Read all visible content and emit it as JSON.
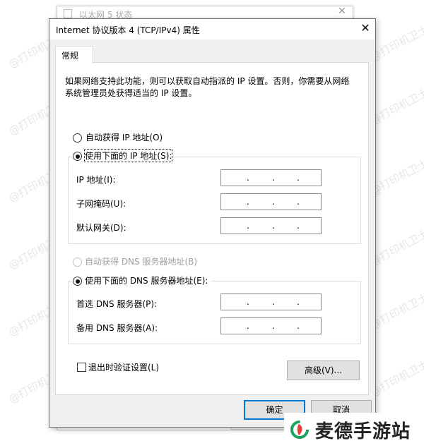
{
  "background_window": {
    "title": "以太网 5 状态"
  },
  "dialog": {
    "title": "Internet 协议版本 4 (TCP/IPv4) 属性",
    "tab_label": "常规",
    "description": "如果网络支持此功能，则可以获取自动指派的 IP 设置。否则，你需要从网络系统管理员处获得适当的 IP 设置。",
    "ip_section": {
      "auto_label": "自动获得 IP 地址(O)",
      "manual_label": "使用下面的 IP 地址(S):",
      "selected": "manual",
      "fields": [
        {
          "label": "IP 地址(I):",
          "value": ". . ."
        },
        {
          "label": "子网掩码(U):",
          "value": ". . ."
        },
        {
          "label": "默认网关(D):",
          "value": ". . ."
        }
      ]
    },
    "dns_section": {
      "auto_label": "自动获得 DNS 服务器地址(B)",
      "manual_label": "使用下面的 DNS 服务器地址(E):",
      "selected": "manual",
      "fields": [
        {
          "label": "首选 DNS 服务器(P):",
          "value": ". . ."
        },
        {
          "label": "备用 DNS 服务器(A):",
          "value": ". . ."
        }
      ]
    },
    "validate_on_exit_label": "退出时验证设置(L)",
    "validate_on_exit_checked": false,
    "advanced_button": "高级(V)...",
    "ok_button": "确定",
    "cancel_button": "取消"
  },
  "watermark_text": "@打印机卫士",
  "logo": {
    "text": "麦德手游站",
    "icon": "green-leaf-logo-icon"
  },
  "colors": {
    "accent": "#0078d7",
    "logo_green": "#1aa360",
    "logo_red": "#e2403a"
  }
}
